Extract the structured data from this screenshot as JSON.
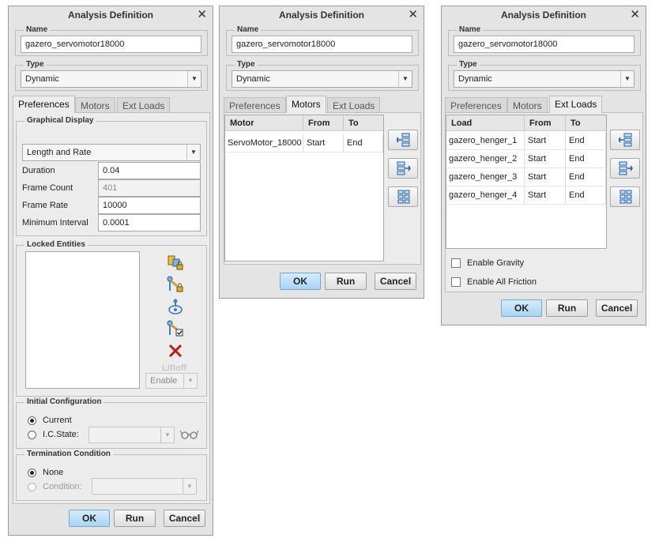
{
  "dialogs": [
    {
      "title": "Analysis Definition",
      "name_label": "Name",
      "name_value": "gazero_servomotor18000",
      "type_label": "Type",
      "type_value": "Dynamic",
      "tabs": [
        "Preferences",
        "Motors",
        "Ext Loads"
      ],
      "active_tab": "Preferences",
      "preferences": {
        "graphical_display_label": "Graphical Display",
        "mode_value": "Length and Rate",
        "duration_label": "Duration",
        "duration_value": "0.04",
        "frame_count_label": "Frame Count",
        "frame_count_value": "401",
        "frame_rate_label": "Frame Rate",
        "frame_rate_value": "10000",
        "min_interval_label": "Minimum Interval",
        "min_interval_value": "0.0001",
        "locked_entities_label": "Locked Entities",
        "liftoff_label": "Liftoff",
        "enable_value": "Enable",
        "initial_config_label": "Initial Configuration",
        "current_label": "Current",
        "ic_state_label": "I.C.State:",
        "termination_label": "Termination Condition",
        "none_label": "None",
        "condition_label": "Condition:"
      },
      "buttons": {
        "ok": "OK",
        "run": "Run",
        "cancel": "Cancel"
      }
    },
    {
      "title": "Analysis Definition",
      "name_label": "Name",
      "name_value": "gazero_servomotor18000",
      "type_label": "Type",
      "type_value": "Dynamic",
      "tabs": [
        "Preferences",
        "Motors",
        "Ext Loads"
      ],
      "active_tab": "Motors",
      "motors": {
        "columns": [
          "Motor",
          "From",
          "To"
        ],
        "rows": [
          [
            "ServoMotor_18000",
            "Start",
            "End"
          ]
        ]
      },
      "buttons": {
        "ok": "OK",
        "run": "Run",
        "cancel": "Cancel"
      }
    },
    {
      "title": "Analysis Definition",
      "name_label": "Name",
      "name_value": "gazero_servomotor18000",
      "type_label": "Type",
      "type_value": "Dynamic",
      "tabs": [
        "Preferences",
        "Motors",
        "Ext Loads"
      ],
      "active_tab": "Ext Loads",
      "ext_loads": {
        "columns": [
          "Load",
          "From",
          "To"
        ],
        "rows": [
          [
            "gazero_henger_1",
            "Start",
            "End"
          ],
          [
            "gazero_henger_2",
            "Start",
            "End"
          ],
          [
            "gazero_henger_3",
            "Start",
            "End"
          ],
          [
            "gazero_henger_4",
            "Start",
            "End"
          ]
        ],
        "enable_gravity_label": "Enable Gravity",
        "enable_friction_label": "Enable All Friction"
      },
      "buttons": {
        "ok": "OK",
        "run": "Run",
        "cancel": "Cancel"
      }
    }
  ],
  "colors": {
    "ok_button": "#a9d4f2",
    "dialog_bg": "#e4e4e4",
    "delete_icon": "#c01818",
    "add_icon": "#1f5fa8"
  }
}
